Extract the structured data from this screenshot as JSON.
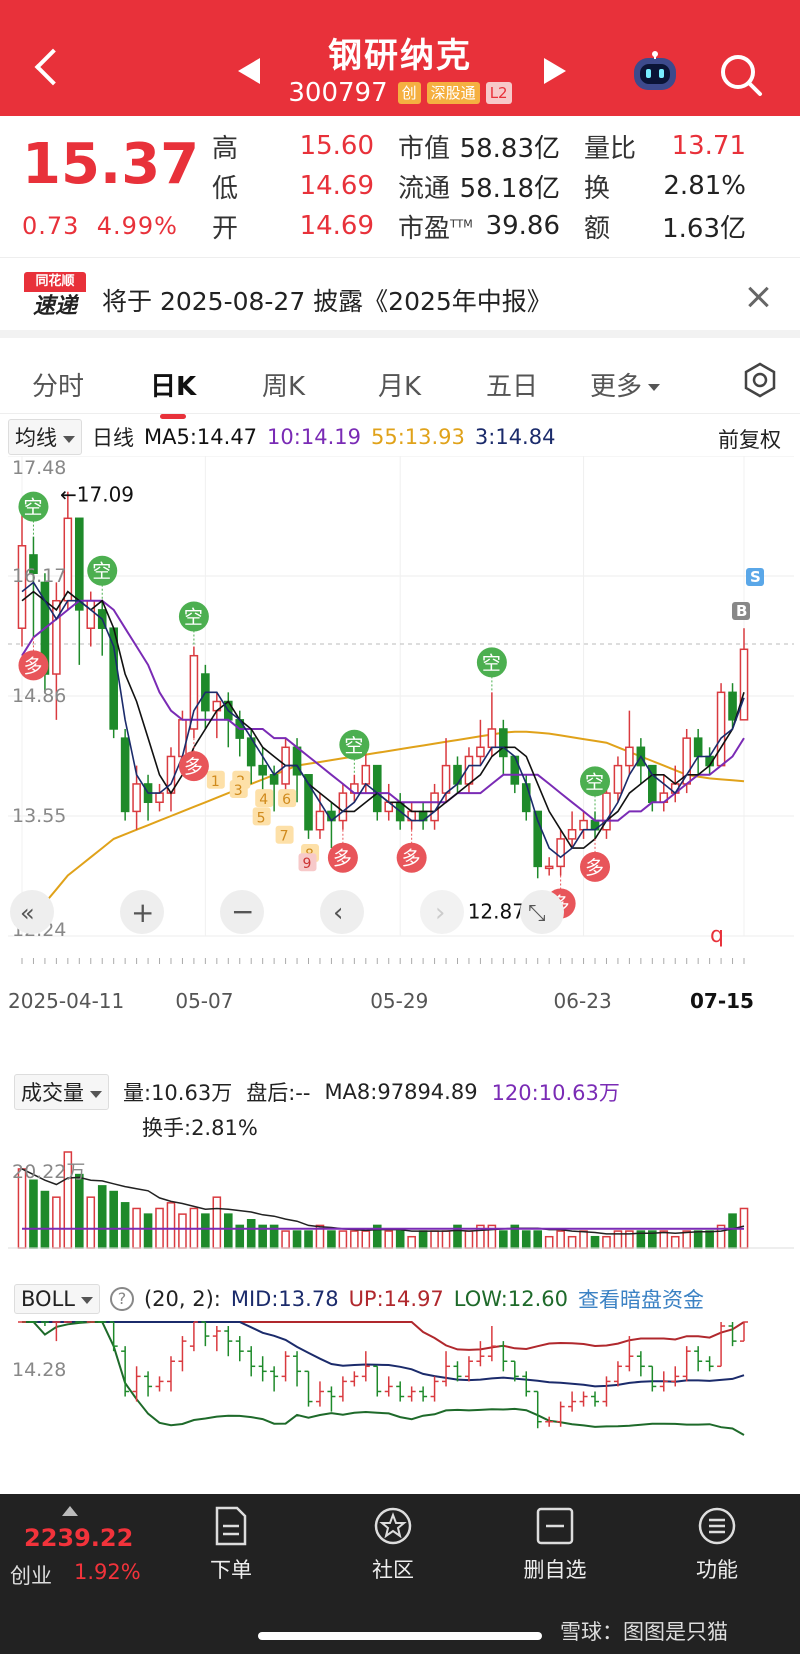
{
  "header": {
    "name": "钢研纳克",
    "code": "300797",
    "tags": [
      "创",
      "深股通",
      "L2"
    ]
  },
  "quote": {
    "price": "15.37",
    "change": "0.73",
    "change_pct": "4.99%",
    "col1": [
      {
        "label": "高",
        "value": "15.60"
      },
      {
        "label": "低",
        "value": "14.69"
      },
      {
        "label": "开",
        "value": "14.69"
      }
    ],
    "col2": [
      {
        "label": "市值",
        "value": "58.83亿"
      },
      {
        "label": "流通",
        "value": "58.18亿"
      },
      {
        "label": "市盈",
        "sup": "TTM",
        "value": "39.86"
      }
    ],
    "col3": [
      {
        "label": "量比",
        "value": "13.71"
      },
      {
        "label": "换",
        "value": "2.81%"
      },
      {
        "label": "额",
        "value": "1.63亿"
      }
    ]
  },
  "notice": {
    "logo_top": "同花顺",
    "logo_bottom": "速递",
    "text": "将于 2025-08-27 披露《2025年中报》"
  },
  "tabs": [
    "分时",
    "日K",
    "周K",
    "月K",
    "五日",
    "更多"
  ],
  "legend": {
    "dropdown": "均线",
    "type": "日线",
    "ma5": "MA5:14.47",
    "ma10": "10:14.19",
    "ma55": "55:13.93",
    "ma3": "3:14.84",
    "adjust": "前复权"
  },
  "colors": {
    "up": "#d93a3f",
    "down": "#1e8a2a",
    "ma5": "#111111",
    "ma10": "#7a2bb5",
    "ma55": "#e0a21a",
    "ma3": "#1b2b6b",
    "accent": "#e8313a"
  },
  "chart_data": {
    "type": "candlestick",
    "y_axis_labels": [
      "17.48",
      "16.17",
      "14.86",
      "13.55",
      "12.24"
    ],
    "x_axis_labels": [
      "2025-04-11",
      "05-07",
      "05-29",
      "06-23",
      "07-15"
    ],
    "max_label": "17.09",
    "min_label": "12.87",
    "ylim": [
      12.24,
      17.48
    ],
    "candles": [
      {
        "o": 15.6,
        "c": 16.5,
        "h": 16.9,
        "l": 15.4
      },
      {
        "o": 16.4,
        "c": 16.2,
        "h": 16.6,
        "l": 15.5
      },
      {
        "o": 16.1,
        "c": 15.1,
        "h": 16.2,
        "l": 14.9
      },
      {
        "o": 15.1,
        "c": 15.9,
        "h": 16.1,
        "l": 14.6
      },
      {
        "o": 15.9,
        "c": 16.8,
        "h": 17.09,
        "l": 15.8
      },
      {
        "o": 16.8,
        "c": 15.8,
        "h": 16.8,
        "l": 15.2
      },
      {
        "o": 15.6,
        "c": 15.9,
        "h": 16.0,
        "l": 15.4
      },
      {
        "o": 15.8,
        "c": 15.6,
        "h": 15.9,
        "l": 15.3
      },
      {
        "o": 15.6,
        "c": 14.5,
        "h": 15.6,
        "l": 14.4
      },
      {
        "o": 14.4,
        "c": 13.6,
        "h": 14.5,
        "l": 13.5
      },
      {
        "o": 13.6,
        "c": 13.9,
        "h": 14.1,
        "l": 13.4
      },
      {
        "o": 13.9,
        "c": 13.7,
        "h": 14.0,
        "l": 13.5
      },
      {
        "o": 13.7,
        "c": 13.8,
        "h": 13.9,
        "l": 13.6
      },
      {
        "o": 13.8,
        "c": 14.2,
        "h": 14.3,
        "l": 13.6
      },
      {
        "o": 14.2,
        "c": 14.6,
        "h": 14.7,
        "l": 14.0
      },
      {
        "o": 14.5,
        "c": 15.3,
        "h": 15.4,
        "l": 14.4
      },
      {
        "o": 15.1,
        "c": 14.7,
        "h": 15.2,
        "l": 14.5
      },
      {
        "o": 14.7,
        "c": 14.8,
        "h": 14.9,
        "l": 14.4
      },
      {
        "o": 14.8,
        "c": 14.6,
        "h": 14.9,
        "l": 14.3
      },
      {
        "o": 14.6,
        "c": 14.4,
        "h": 14.7,
        "l": 14.2
      },
      {
        "o": 14.4,
        "c": 14.1,
        "h": 14.5,
        "l": 13.9
      },
      {
        "o": 14.1,
        "c": 14.0,
        "h": 14.3,
        "l": 13.8
      },
      {
        "o": 14.0,
        "c": 13.9,
        "h": 14.1,
        "l": 13.6
      },
      {
        "o": 13.9,
        "c": 14.3,
        "h": 14.4,
        "l": 13.8
      },
      {
        "o": 14.3,
        "c": 14.0,
        "h": 14.4,
        "l": 13.7
      },
      {
        "o": 14.0,
        "c": 13.4,
        "h": 14.0,
        "l": 13.3
      },
      {
        "o": 13.4,
        "c": 13.6,
        "h": 13.8,
        "l": 13.3
      },
      {
        "o": 13.6,
        "c": 13.5,
        "h": 13.7,
        "l": 13.2
      },
      {
        "o": 13.5,
        "c": 13.8,
        "h": 13.9,
        "l": 13.4
      },
      {
        "o": 13.8,
        "c": 13.9,
        "h": 14.0,
        "l": 13.7
      },
      {
        "o": 13.9,
        "c": 14.1,
        "h": 14.4,
        "l": 13.8
      },
      {
        "o": 14.1,
        "c": 13.6,
        "h": 14.1,
        "l": 13.5
      },
      {
        "o": 13.6,
        "c": 13.7,
        "h": 13.9,
        "l": 13.5
      },
      {
        "o": 13.7,
        "c": 13.5,
        "h": 13.8,
        "l": 13.4
      },
      {
        "o": 13.5,
        "c": 13.6,
        "h": 13.7,
        "l": 13.4
      },
      {
        "o": 13.6,
        "c": 13.5,
        "h": 13.7,
        "l": 13.4
      },
      {
        "o": 13.5,
        "c": 13.8,
        "h": 13.9,
        "l": 13.4
      },
      {
        "o": 13.8,
        "c": 14.1,
        "h": 14.4,
        "l": 13.7
      },
      {
        "o": 14.1,
        "c": 13.9,
        "h": 14.2,
        "l": 13.8
      },
      {
        "o": 13.9,
        "c": 14.2,
        "h": 14.3,
        "l": 13.8
      },
      {
        "o": 14.2,
        "c": 14.3,
        "h": 14.6,
        "l": 14.1
      },
      {
        "o": 14.3,
        "c": 14.5,
        "h": 14.9,
        "l": 14.2
      },
      {
        "o": 14.5,
        "c": 14.2,
        "h": 14.6,
        "l": 14.0
      },
      {
        "o": 14.2,
        "c": 13.9,
        "h": 14.2,
        "l": 13.8
      },
      {
        "o": 13.9,
        "c": 13.6,
        "h": 14.0,
        "l": 13.5
      },
      {
        "o": 13.6,
        "c": 13.0,
        "h": 13.6,
        "l": 12.87
      },
      {
        "o": 13.0,
        "c": 13.0,
        "h": 13.1,
        "l": 12.9
      },
      {
        "o": 13.0,
        "c": 13.3,
        "h": 13.4,
        "l": 12.9
      },
      {
        "o": 13.3,
        "c": 13.4,
        "h": 13.6,
        "l": 13.2
      },
      {
        "o": 13.4,
        "c": 13.5,
        "h": 13.6,
        "l": 13.3
      },
      {
        "o": 13.5,
        "c": 13.4,
        "h": 13.6,
        "l": 13.3
      },
      {
        "o": 13.4,
        "c": 13.8,
        "h": 13.9,
        "l": 13.3
      },
      {
        "o": 13.8,
        "c": 14.1,
        "h": 14.2,
        "l": 13.7
      },
      {
        "o": 14.1,
        "c": 14.3,
        "h": 14.7,
        "l": 14.0
      },
      {
        "o": 14.3,
        "c": 14.1,
        "h": 14.4,
        "l": 13.9
      },
      {
        "o": 14.1,
        "c": 13.7,
        "h": 14.1,
        "l": 13.6
      },
      {
        "o": 13.7,
        "c": 13.8,
        "h": 14.0,
        "l": 13.6
      },
      {
        "o": 13.8,
        "c": 13.9,
        "h": 14.1,
        "l": 13.7
      },
      {
        "o": 13.9,
        "c": 14.4,
        "h": 14.5,
        "l": 13.8
      },
      {
        "o": 14.4,
        "c": 14.2,
        "h": 14.5,
        "l": 14.0
      },
      {
        "o": 14.2,
        "c": 14.1,
        "h": 14.3,
        "l": 14.0
      },
      {
        "o": 14.1,
        "c": 14.9,
        "h": 15.0,
        "l": 14.1
      },
      {
        "o": 14.9,
        "c": 14.6,
        "h": 15.0,
        "l": 14.5
      },
      {
        "o": 14.6,
        "c": 15.37,
        "h": 15.6,
        "l": 14.6
      }
    ],
    "ma5": [
      15.9,
      16.0,
      15.9,
      15.8,
      16.0,
      15.9,
      15.8,
      15.9,
      15.6,
      15.1,
      14.8,
      14.4,
      14.0,
      13.8,
      14.0,
      14.3,
      14.5,
      14.7,
      14.8,
      14.6,
      14.5,
      14.3,
      14.2,
      14.1,
      14.1,
      13.9,
      13.8,
      13.7,
      13.6,
      13.6,
      13.7,
      13.8,
      13.7,
      13.7,
      13.6,
      13.6,
      13.6,
      13.7,
      13.8,
      13.9,
      14.0,
      14.2,
      14.3,
      14.3,
      14.2,
      13.9,
      13.6,
      13.4,
      13.2,
      13.2,
      13.3,
      13.5,
      13.6,
      13.8,
      13.9,
      14.0,
      14.0,
      13.9,
      14.0,
      14.0,
      14.1,
      14.3,
      14.5,
      14.9
    ],
    "ma10": [
      15.3,
      15.5,
      15.6,
      15.7,
      15.8,
      15.9,
      15.9,
      15.9,
      15.8,
      15.6,
      15.4,
      15.2,
      14.9,
      14.7,
      14.6,
      14.6,
      14.6,
      14.6,
      14.6,
      14.5,
      14.5,
      14.5,
      14.4,
      14.4,
      14.3,
      14.2,
      14.1,
      14.0,
      13.9,
      13.8,
      13.8,
      13.8,
      13.8,
      13.7,
      13.7,
      13.7,
      13.7,
      13.7,
      13.8,
      13.8,
      13.8,
      13.9,
      14.0,
      14.0,
      14.0,
      14.0,
      13.9,
      13.8,
      13.7,
      13.6,
      13.5,
      13.5,
      13.5,
      13.6,
      13.6,
      13.7,
      13.7,
      13.8,
      13.9,
      14.0,
      14.0,
      14.1,
      14.2,
      14.4
    ],
    "ma55": [
      12.3,
      12.45,
      12.6,
      12.75,
      12.9,
      13.0,
      13.1,
      13.2,
      13.3,
      13.35,
      13.4,
      13.45,
      13.5,
      13.55,
      13.6,
      13.65,
      13.7,
      13.75,
      13.8,
      13.85,
      13.9,
      13.95,
      14.0,
      14.05,
      14.1,
      14.12,
      14.14,
      14.16,
      14.18,
      14.2,
      14.22,
      14.24,
      14.26,
      14.28,
      14.3,
      14.32,
      14.34,
      14.36,
      14.38,
      14.4,
      14.42,
      14.44,
      14.46,
      14.47,
      14.47,
      14.46,
      14.45,
      14.43,
      14.41,
      14.39,
      14.37,
      14.35,
      14.3,
      14.25,
      14.2,
      14.15,
      14.1,
      14.05,
      14.0,
      13.98,
      13.96,
      13.95,
      13.94,
      13.93
    ],
    "ma3": [
      16.0,
      16.1,
      15.9,
      15.7,
      15.9,
      15.9,
      15.8,
      15.7,
      15.4,
      14.6,
      14.0,
      13.8,
      13.8,
      13.9,
      14.2,
      14.7,
      14.9,
      14.9,
      14.7,
      14.6,
      14.4,
      14.2,
      14.0,
      14.1,
      14.1,
      13.9,
      13.7,
      13.5,
      13.6,
      13.7,
      13.9,
      13.8,
      13.7,
      13.6,
      13.5,
      13.5,
      13.6,
      13.8,
      13.9,
      14.1,
      14.1,
      14.3,
      14.3,
      14.2,
      13.9,
      13.5,
      13.2,
      13.1,
      13.2,
      13.4,
      13.4,
      13.5,
      13.7,
      14.0,
      14.2,
      14.0,
      13.9,
      13.8,
      14.0,
      14.2,
      14.2,
      14.4,
      14.5,
      14.84
    ],
    "signals": [
      {
        "i": 1,
        "text": "空",
        "kind": "sell"
      },
      {
        "i": 1,
        "text": "多",
        "kind": "buy"
      },
      {
        "i": 7,
        "text": "空",
        "kind": "sell"
      },
      {
        "i": 15,
        "text": "空",
        "kind": "sell"
      },
      {
        "i": 15,
        "text": "多",
        "kind": "buy"
      },
      {
        "i": 29,
        "text": "空",
        "kind": "sell"
      },
      {
        "i": 28,
        "text": "多",
        "kind": "buy"
      },
      {
        "i": 34,
        "text": "多",
        "kind": "buy"
      },
      {
        "i": 41,
        "text": "空",
        "kind": "sell"
      },
      {
        "i": 47,
        "text": "多",
        "kind": "buy"
      },
      {
        "i": 50,
        "text": "空",
        "kind": "sell"
      },
      {
        "i": 50,
        "text": "多",
        "kind": "buy"
      }
    ],
    "count_labels": [
      "1",
      "2",
      "3",
      "4",
      "5",
      "6",
      "7",
      "8",
      "9"
    ],
    "marks": {
      "b": "B",
      "s": "S",
      "q": "q"
    }
  },
  "volume": {
    "dropdown": "成交量",
    "vol": "量:10.63万",
    "after": "盘后:--",
    "ma8": "MA8:97894.89",
    "ma120": "120:10.63万",
    "turnover": "换手:2.81%",
    "y_label": "20.22万",
    "bars": [
      14,
      12,
      10,
      9,
      17,
      13,
      9,
      11,
      10,
      8,
      7,
      6,
      7,
      8,
      6,
      7,
      6,
      9,
      6,
      4,
      5,
      4,
      4,
      3,
      3,
      3,
      4,
      3,
      3,
      3,
      3,
      4,
      3,
      3,
      2,
      3,
      3,
      3,
      4,
      3,
      4,
      4,
      3,
      4,
      3,
      3,
      2,
      3,
      2,
      3,
      2,
      2,
      3,
      3,
      3,
      3,
      3,
      2,
      3,
      3,
      3,
      4,
      6,
      7
    ]
  },
  "boll": {
    "dropdown": "BOLL",
    "help": "?",
    "params": "(20, 2):",
    "mid": "MID:13.78",
    "up": "UP:14.97",
    "low": "LOW:12.60",
    "link": "查看暗盘资金",
    "y_label": "14.28"
  },
  "bottom": {
    "index_value": "2239.22",
    "index_name": "创业",
    "index_pct": "1.92%",
    "items": [
      "下单",
      "社区",
      "删自选",
      "功能"
    ],
    "watermark": "雪球：图图是只猫"
  }
}
